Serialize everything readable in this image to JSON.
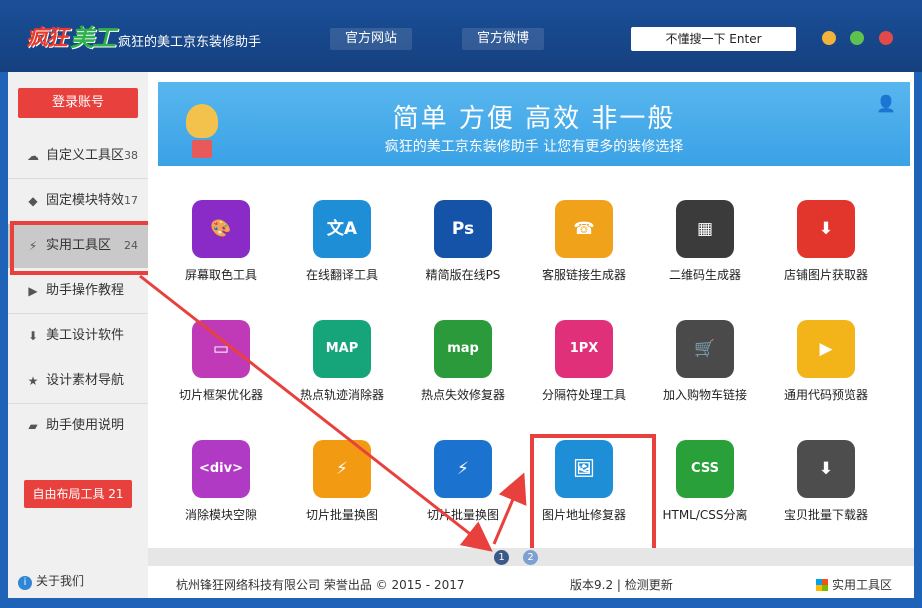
{
  "window": {
    "logo_text_1": "疯狂",
    "logo_text_2": "美工",
    "logo_sub": "meigongtools",
    "title": "疯狂的美工京东装修助手",
    "link_site": "官方网站",
    "link_weibo": "官方微博",
    "search_text": "不懂搜一下 Enter"
  },
  "sidebar": {
    "login": "登录账号",
    "items": [
      {
        "label": "自定义工具区",
        "count": "38",
        "icon": "cloud-icon"
      },
      {
        "label": "固定模块特效",
        "count": "17",
        "icon": "cube-icon"
      },
      {
        "label": "实用工具区",
        "count": "24",
        "icon": "lightning-icon"
      },
      {
        "label": "助手操作教程",
        "count": "",
        "icon": "play-icon"
      },
      {
        "label": "美工设计软件",
        "count": "",
        "icon": "download-icon"
      },
      {
        "label": "设计素材导航",
        "count": "",
        "icon": "star-icon"
      },
      {
        "label": "助手使用说明",
        "count": "",
        "icon": "book-icon"
      }
    ],
    "custom_layout": "自由布局工具",
    "custom_layout_count": "21",
    "about": "关于我们"
  },
  "banner": {
    "slogan": "简单 方便 高效 非一般",
    "sub": "疯狂的美工京东装修助手 让您有更多的装修选择"
  },
  "tools": [
    {
      "name": "屏幕取色工具",
      "icon": "palette-icon",
      "glyph": "🎨",
      "color": "#8a2bc7"
    },
    {
      "name": "在线翻译工具",
      "icon": "translate-icon",
      "glyph": "文A",
      "color": "#1e8fd6"
    },
    {
      "name": "精简版在线PS",
      "icon": "photoshop-icon",
      "glyph": "Ps",
      "color": "#1553a8"
    },
    {
      "name": "客服链接生成器",
      "icon": "headset-icon",
      "glyph": "☎",
      "color": "#f0a21a"
    },
    {
      "name": "二维码生成器",
      "icon": "qrcode-icon",
      "glyph": "▦",
      "color": "#3b3b3b"
    },
    {
      "name": "店铺图片获取器",
      "icon": "image-download-icon",
      "glyph": "⬇",
      "color": "#e2352b"
    },
    {
      "name": "切片框架优化器",
      "icon": "frame-icon",
      "glyph": "▭",
      "color": "#c03ab8"
    },
    {
      "name": "热点轨迹消除器",
      "icon": "map-icon",
      "glyph": "MAP",
      "color": "#16a57a"
    },
    {
      "name": "热点失效修复器",
      "icon": "map-pin-icon",
      "glyph": "map",
      "color": "#2a9a3a"
    },
    {
      "name": "分隔符处理工具",
      "icon": "pixel-icon",
      "glyph": "1PX",
      "color": "#e0307a"
    },
    {
      "name": "加入购物车链接",
      "icon": "cart-icon",
      "glyph": "🛒",
      "color": "#4a4a4a"
    },
    {
      "name": "通用代码预览器",
      "icon": "preview-icon",
      "glyph": "▶",
      "color": "#f2b418"
    },
    {
      "name": "消除模块空隙",
      "icon": "div-icon",
      "glyph": "<div>",
      "color": "#b13ac4"
    },
    {
      "name": "切片批量换图",
      "icon": "slice-icon",
      "glyph": "⚡",
      "color": "#f29a12"
    },
    {
      "name": "切片批量换图",
      "icon": "slice-blue-icon",
      "glyph": "⚡",
      "color": "#1b73cf"
    },
    {
      "name": "图片地址修复器",
      "icon": "image-link-icon",
      "glyph": "🖼",
      "color": "#1e8fd6"
    },
    {
      "name": "HTML/CSS分离",
      "icon": "css-icon",
      "glyph": "CSS",
      "color": "#2aa03a"
    },
    {
      "name": "宝贝批量下载器",
      "icon": "batch-download-icon",
      "glyph": "⬇",
      "color": "#4d4d4d"
    }
  ],
  "pager": {
    "p1": "1",
    "p2": "2"
  },
  "footer": {
    "copyright": "杭州锋狂网络科技有限公司 荣誉出品 © 2015 - 2017",
    "version": "版本9.2 | 检测更新",
    "current": "实用工具区"
  }
}
